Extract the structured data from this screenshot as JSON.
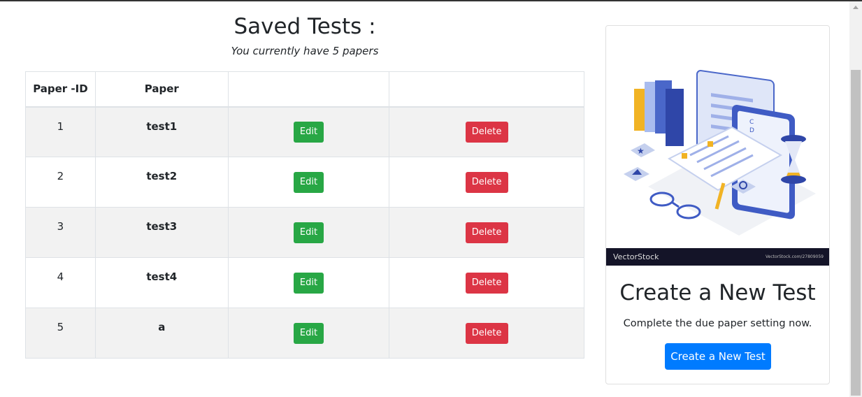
{
  "header": {
    "title": "Saved Tests :",
    "subtitle": "You currently have 5 papers"
  },
  "table": {
    "columns": [
      "Paper -ID",
      "Paper",
      "",
      ""
    ],
    "rows": [
      {
        "id": "1",
        "paper": "test1",
        "edit": "Edit",
        "delete": "Delete"
      },
      {
        "id": "2",
        "paper": "test2",
        "edit": "Edit",
        "delete": "Delete"
      },
      {
        "id": "3",
        "paper": "test3",
        "edit": "Edit",
        "delete": "Delete"
      },
      {
        "id": "4",
        "paper": "test4",
        "edit": "Edit",
        "delete": "Delete"
      },
      {
        "id": "5",
        "paper": "a",
        "edit": "Edit",
        "delete": "Delete"
      }
    ]
  },
  "card": {
    "watermark_logo": "VectorStock",
    "watermark_url": "VectorStock.com/27809059",
    "title": "Create a New Test",
    "text": "Complete the due paper setting now.",
    "button_label": "Create a New Test"
  },
  "colors": {
    "edit": "#28a745",
    "delete": "#dc3545",
    "primary": "#007bff",
    "stripe": "#f2f2f2"
  }
}
